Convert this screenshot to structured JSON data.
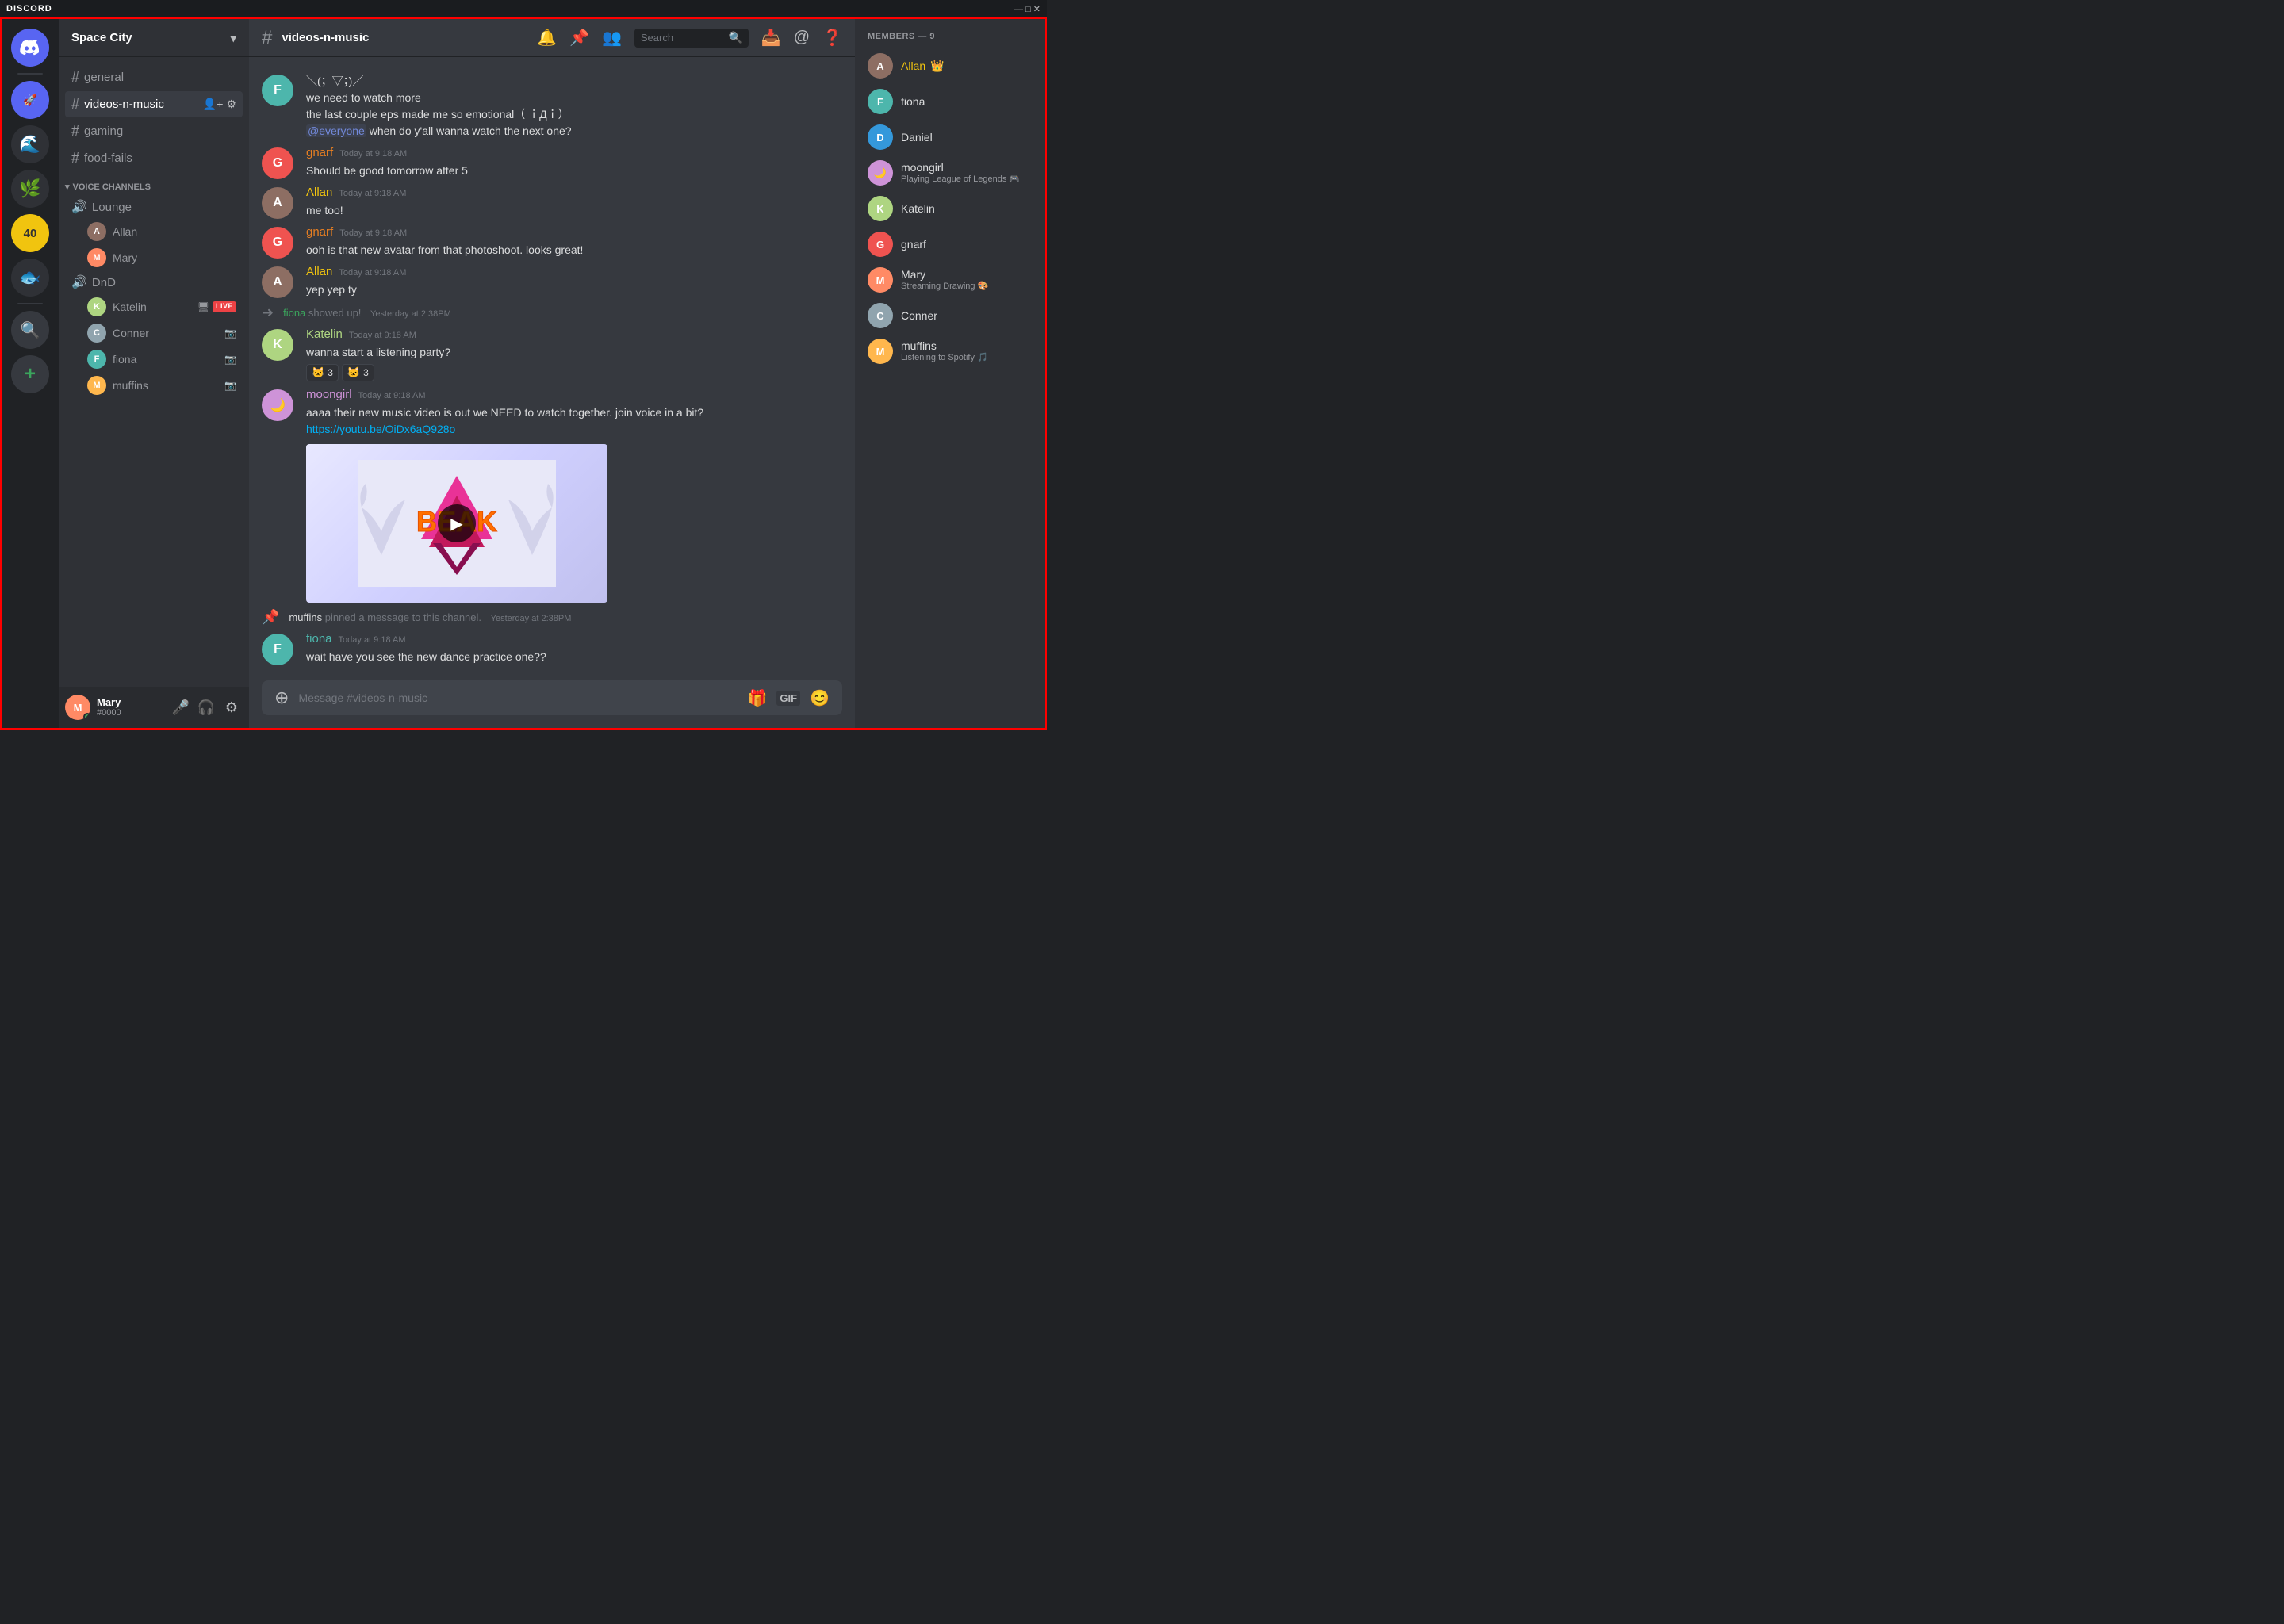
{
  "titlebar": {
    "logo": "DISCORD",
    "controls": [
      "minimize",
      "maximize",
      "close"
    ]
  },
  "server": {
    "name": "Space City",
    "chevron": "▾"
  },
  "channels": {
    "text": [
      {
        "id": "general",
        "name": "general",
        "active": false
      },
      {
        "id": "videos-n-music",
        "name": "videos-n-music",
        "active": true
      },
      {
        "id": "gaming",
        "name": "gaming",
        "active": false
      },
      {
        "id": "food-fails",
        "name": "food-fails",
        "active": false
      }
    ],
    "voice_header": "VOICE CHANNELS",
    "voice": [
      {
        "id": "lounge",
        "name": "Lounge",
        "users": [
          {
            "name": "Allan",
            "color": "allan-color"
          },
          {
            "name": "Mary",
            "color": "mary-color"
          }
        ]
      },
      {
        "id": "dnd",
        "name": "DnD",
        "users": [
          {
            "name": "Katelin",
            "color": "katelin-color",
            "live": true
          },
          {
            "name": "Conner",
            "color": "conner-color",
            "video": true
          },
          {
            "name": "fiona",
            "color": "fiona-color",
            "video": true
          },
          {
            "name": "muffins",
            "color": "muffins-color",
            "video": true
          }
        ]
      }
    ]
  },
  "active_channel": {
    "name": "videos-n-music"
  },
  "header_actions": {
    "bell_label": "bell",
    "pin_label": "pin",
    "members_label": "members",
    "search_placeholder": "Search",
    "inbox_label": "inbox",
    "at_label": "mention",
    "help_label": "help"
  },
  "messages": [
    {
      "id": 1,
      "author": "fiona",
      "color": "fiona-color",
      "timestamp": "",
      "lines": [
        "＼(；▽；)／",
        "we need to watch more",
        "the last couple eps made me so emotional（ ｉДｉ）",
        "@everyone when do y'all wanna watch the next one?"
      ],
      "type": "continued"
    },
    {
      "id": 2,
      "author": "gnarf",
      "color": "gnarf-color",
      "timestamp": "Today at 9:18 AM",
      "lines": [
        "Should be good tomorrow after 5"
      ]
    },
    {
      "id": 3,
      "author": "Allan",
      "color": "allan-color",
      "timestamp": "Today at 9:18 AM",
      "lines": [
        "me too!"
      ]
    },
    {
      "id": 4,
      "author": "gnarf",
      "color": "gnarf-color",
      "timestamp": "Today at 9:18 AM",
      "lines": [
        "ooh is that new avatar from that photoshoot. looks great!"
      ]
    },
    {
      "id": 5,
      "author": "Allan",
      "color": "allan-color",
      "timestamp": "Today at 9:18 AM",
      "lines": [
        "yep yep ty"
      ]
    },
    {
      "id": 6,
      "author": "fiona",
      "color": "fiona-color",
      "timestamp": "Yesterday at 2:38PM",
      "type": "join",
      "lines": [
        "showed up!"
      ]
    },
    {
      "id": 7,
      "author": "Katelin",
      "color": "katelin-color",
      "timestamp": "Today at 9:18 AM",
      "lines": [
        "wanna start a listening party?"
      ],
      "reactions": [
        {
          "emoji": "🐱",
          "count": 3
        },
        {
          "emoji": "🐱",
          "count": 3
        }
      ]
    },
    {
      "id": 8,
      "author": "moongirl",
      "color": "moongirl-color",
      "timestamp": "Today at 9:18 AM",
      "lines": [
        "aaaa their new music video is out we NEED to watch together. join voice in a bit?"
      ],
      "link": "https://youtu.be/OiDx6aQ928o",
      "has_video": true
    },
    {
      "id": 9,
      "type": "system",
      "text": "muffins",
      "system_text": " pinned a message to this channel.",
      "timestamp": "Yesterday at 2:38PM"
    },
    {
      "id": 10,
      "author": "fiona",
      "color": "fiona-color",
      "timestamp": "Today at 9:18 AM",
      "lines": [
        "wait have you see the new dance practice one??"
      ]
    }
  ],
  "message_input": {
    "placeholder": "Message #videos-n-music"
  },
  "members": {
    "header": "MEMBERS — 9",
    "list": [
      {
        "name": "Allan",
        "color": "allan-color",
        "crown": true,
        "status": ""
      },
      {
        "name": "fiona",
        "color": "fiona-color",
        "status": ""
      },
      {
        "name": "Daniel",
        "color": "av-blue",
        "status": ""
      },
      {
        "name": "moongirl",
        "color": "moongirl-color",
        "status": "Playing League of Legends 🎮"
      },
      {
        "name": "Katelin",
        "color": "katelin-color",
        "status": ""
      },
      {
        "name": "gnarf",
        "color": "gnarf-color",
        "status": ""
      },
      {
        "name": "Mary",
        "color": "mary-color",
        "status": "Streaming Drawing 🎨"
      },
      {
        "name": "Conner",
        "color": "conner-color",
        "status": ""
      },
      {
        "name": "muffins",
        "color": "muffins-color",
        "status": "Listening to Spotify 🎵"
      }
    ]
  },
  "user_panel": {
    "name": "Mary",
    "tag": "#0000",
    "color": "mary-color"
  },
  "icon_servers": [
    {
      "id": "discord",
      "label": "Discord"
    },
    {
      "id": "s1",
      "label": "🚀"
    },
    {
      "id": "s2",
      "label": "🌊"
    },
    {
      "id": "s3",
      "label": "🌿"
    },
    {
      "id": "s4",
      "label": "40"
    },
    {
      "id": "s5",
      "label": "🐟"
    },
    {
      "id": "explore",
      "label": "🔍"
    },
    {
      "id": "add",
      "label": "+"
    }
  ]
}
